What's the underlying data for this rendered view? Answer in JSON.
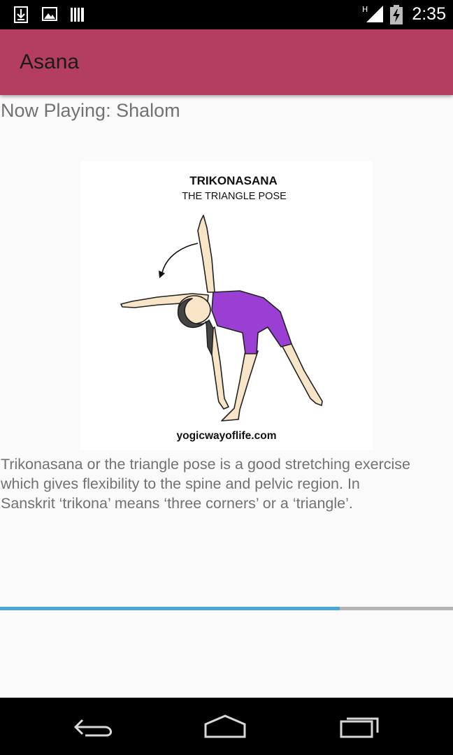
{
  "status_bar": {
    "time": "2:35",
    "network": "H",
    "icons": [
      "download-icon",
      "image-icon",
      "barcode-icon",
      "signal-icon",
      "battery-charging-icon"
    ]
  },
  "app_bar": {
    "title": "Asana"
  },
  "now_playing": "Now Playing: Shalom",
  "pose_image": {
    "title": "TRIKONASANA",
    "subtitle": "THE TRIANGLE POSE",
    "credit": "yogicwayoflife.com"
  },
  "description": "Trikonasana or the triangle pose is a good stretching exercise\nwhich gives flexibility to the spine and pelvic region. In\nSanskrit ‘trikona’ means ‘three corners’ or a ‘triangle’.",
  "progress": {
    "fraction": 0.75
  },
  "nav": {
    "icons": [
      "back-icon",
      "home-icon",
      "recents-icon"
    ]
  },
  "colors": {
    "app_bar": "#b33e5f",
    "progress": "#4aa6d6",
    "pose_suit": "#9b3fd4"
  }
}
